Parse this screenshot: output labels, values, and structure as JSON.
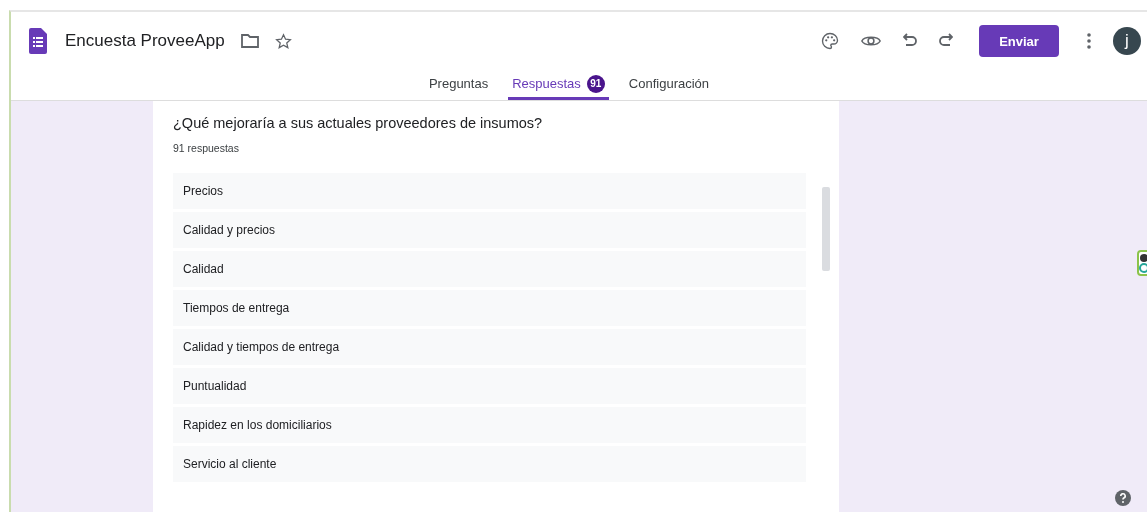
{
  "header": {
    "title": "Encuesta ProveeApp",
    "send_button": "Enviar",
    "avatar": "j"
  },
  "tabs": [
    {
      "label": "Preguntas",
      "selected": false
    },
    {
      "label": "Respuestas",
      "selected": true,
      "badge": "91"
    },
    {
      "label": "Configuración",
      "selected": false
    }
  ],
  "question": {
    "title": "¿Qué mejoraría a sus actuales proveedores de insumos?",
    "count": "91 respuestas",
    "answers": [
      "Precios",
      "Calidad y precios",
      "Calidad",
      "Tiempos de entrega",
      "Calidad y tiempos de entrega",
      "Puntualidad",
      "Rapidez en los domiciliarios",
      "Servicio al cliente"
    ]
  }
}
